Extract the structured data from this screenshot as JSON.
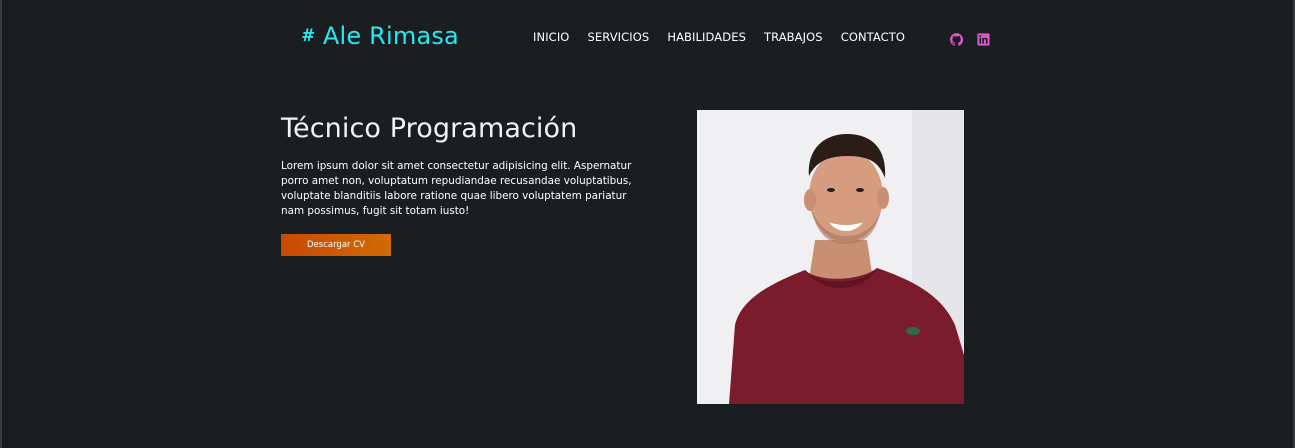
{
  "header": {
    "logo_symbol": "#",
    "logo_name": "Ale Rimasa",
    "nav": [
      "INICIO",
      "SERVICIOS",
      "HABILIDADES",
      "TRABAJOS",
      "CONTACTO"
    ],
    "social_icons": [
      "github-icon",
      "linkedin-icon"
    ],
    "accent_color": "#25e8f0",
    "social_color": "#d957c8"
  },
  "hero": {
    "title": "Técnico Programación",
    "description": "Lorem ipsum dolor sit amet consectetur adipisicing elit. Aspernatur porro amet non, voluptatum repudiandae recusandae voluptatibus, voluptate blanditiis labore ratione quae libero voluptatem pariatur nam possimus, fugit sit totam iusto!",
    "button_label": "Descargar CV",
    "button_color": "#c84a05"
  },
  "photo": {
    "alt": "portrait photo",
    "shirt_color": "#7a1c2c",
    "background_color": "#e6e6ea"
  },
  "page": {
    "background": "#1b1e20"
  }
}
